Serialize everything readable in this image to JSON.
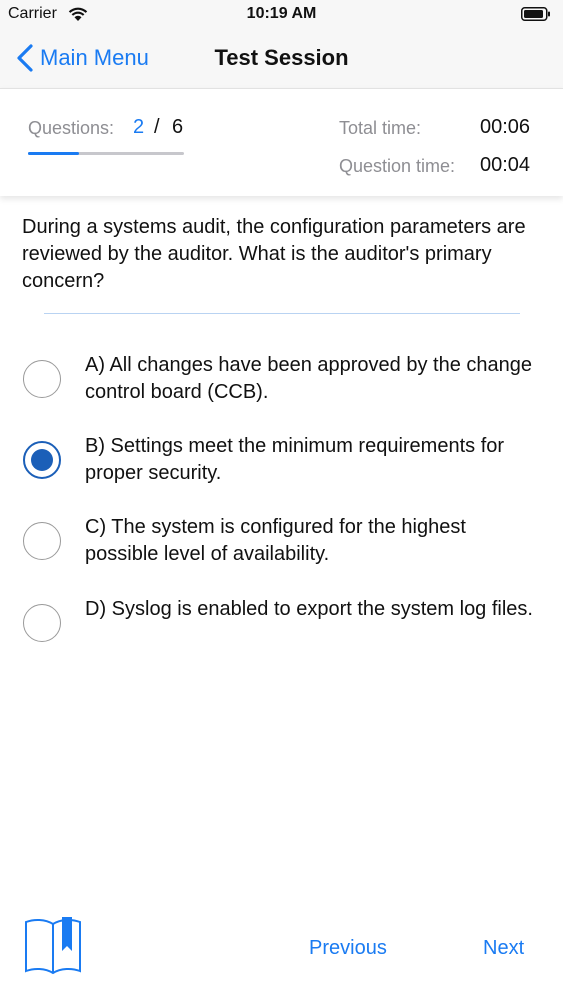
{
  "status_bar": {
    "carrier": "Carrier",
    "time": "10:19 AM",
    "icons": [
      "wifi-icon",
      "battery-icon"
    ]
  },
  "nav": {
    "back_label": "Main Menu",
    "back_icon": "chevron-left-icon",
    "title": "Test Session"
  },
  "session": {
    "questions_label": "Questions:",
    "current_question": "2",
    "separator": "/",
    "total_questions": "6",
    "progress_fraction": 0.33,
    "total_time_label": "Total time:",
    "total_time": "00:06",
    "question_time_label": "Question time:",
    "question_time": "00:04"
  },
  "question": {
    "text": "During a systems audit, the configuration parameters are reviewed by the auditor. What is the auditor's primary concern?"
  },
  "answers": [
    {
      "text": "A) All changes have been approved by the change control board (CCB).",
      "selected": false
    },
    {
      "text": "B) Settings meet the minimum requirements for proper security.",
      "selected": true
    },
    {
      "text": "C) The system is configured for the highest possible level of availability.",
      "selected": false
    },
    {
      "text": "D) Syslog is enabled to export the system log files.",
      "selected": false
    }
  ],
  "footer": {
    "book_icon": "bookmark-book-icon",
    "previous_label": "Previous",
    "next_label": "Next"
  },
  "colors": {
    "accent": "#1a7bf2",
    "selected_radio": "#1b5fb8",
    "secondary_text": "#8e8e93",
    "divider": "#b9d3f2"
  }
}
